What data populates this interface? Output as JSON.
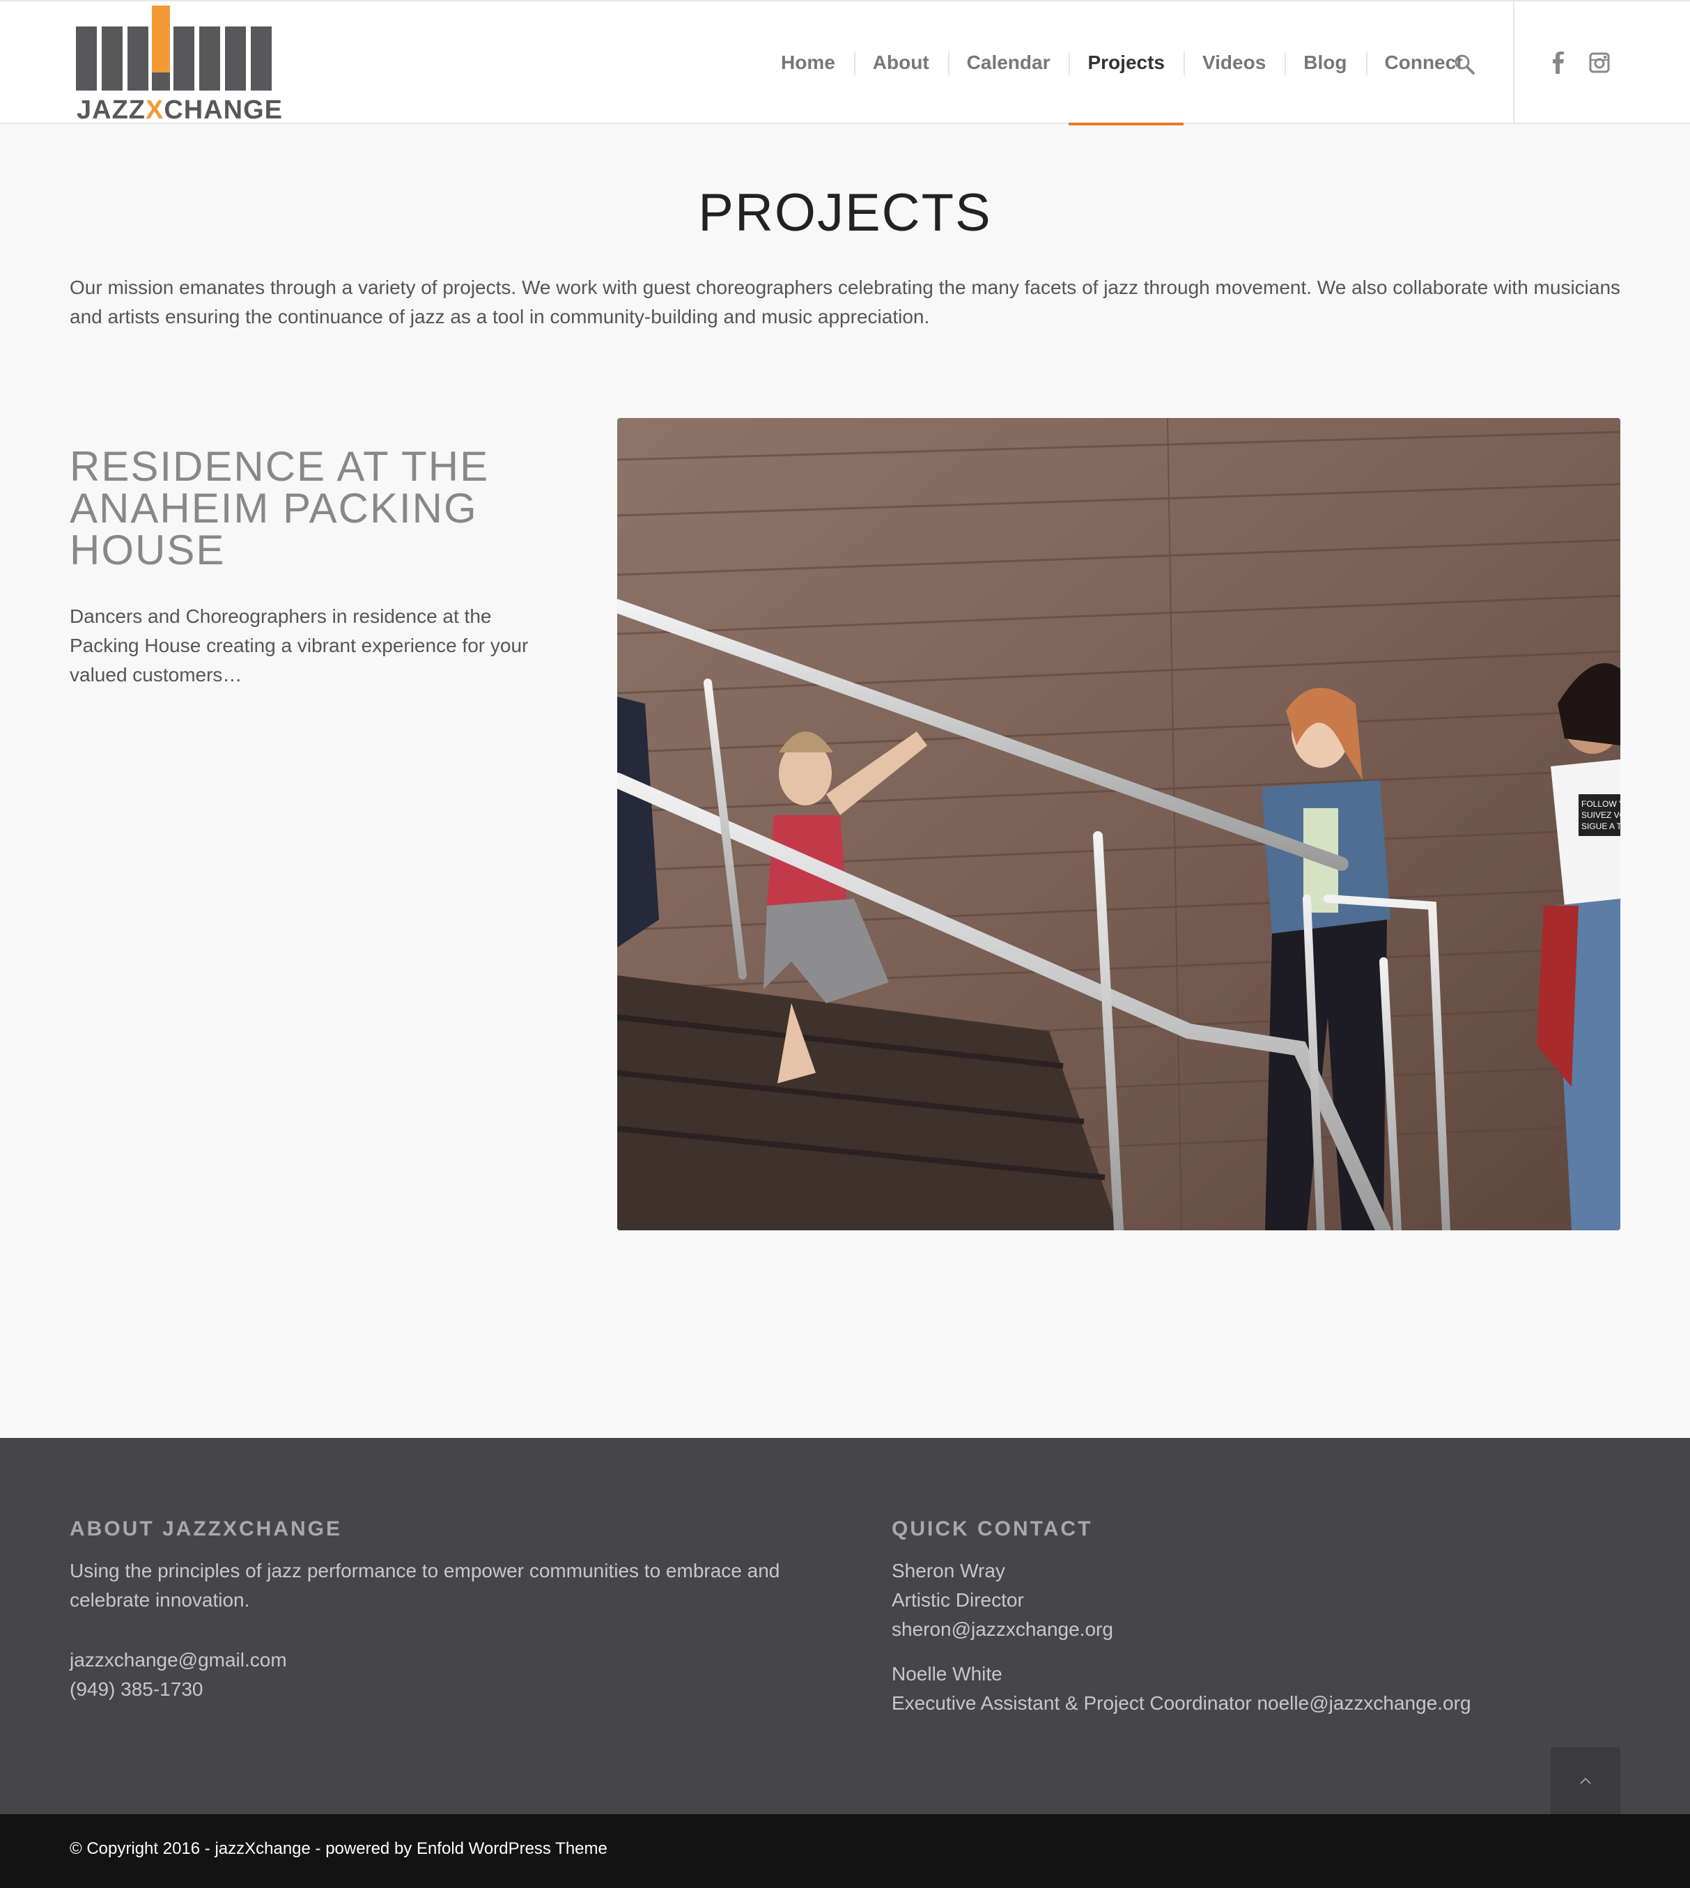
{
  "brand": {
    "name": "jazzXchange",
    "logo_text_left": "JAZZ",
    "logo_text_x": "X",
    "logo_text_right": "CHANGE",
    "colors": {
      "gray": "#58585a",
      "orange": "#f29a36",
      "accent": "#ea7a2e"
    }
  },
  "nav": {
    "items": [
      {
        "label": "Home",
        "active": false
      },
      {
        "label": "About",
        "active": false
      },
      {
        "label": "Calendar",
        "active": false
      },
      {
        "label": "Projects",
        "active": true
      },
      {
        "label": "Videos",
        "active": false
      },
      {
        "label": "Blog",
        "active": false
      },
      {
        "label": "Connect",
        "active": false
      }
    ],
    "search_icon": "search-icon",
    "social_icons": [
      "facebook-icon",
      "instagram-icon"
    ]
  },
  "main": {
    "title": "PROJECTS",
    "mission": "Our mission emanates through a variety of projects. We work with guest choreographers celebrating the many facets of jazz through movement. We also collaborate with musicians and artists ensuring the continuance of jazz as a tool in community-building and music appreciation.",
    "project": {
      "title_line1": "RESIDENCE AT THE",
      "title_line2": "ANAHEIM PACKING",
      "title_line3": "HOUSE",
      "description": "Dancers and Choreographers in residence at the Packing House creating a vibrant experience for your valued customers…",
      "photo_shirt_text_1": "FOLLOW YOUR",
      "photo_shirt_text_2": "SUIVEZ VOTRE",
      "photo_shirt_text_3": "SIGUE A TU C"
    }
  },
  "footer": {
    "about": {
      "heading": "ABOUT JAZZXCHANGE",
      "text_line1": "Using the principles of jazz performance to empower communities to embrace and",
      "text_line2": "celebrate innovation.",
      "email": "jazzxchange@gmail.com",
      "phone": "(949) 385-1730"
    },
    "contact": {
      "heading": "QUICK CONTACT",
      "person1_name": "Sheron Wray",
      "person1_role": "Artistic Director",
      "person1_email": "sheron@jazzxchange.org",
      "person2_name": "Noelle White",
      "person2_role_email": "Executive Assistant & Project Coordinator noelle@jazzxchange.org"
    },
    "copyright": "© Copyright 2016 - jazzXchange - powered by Enfold WordPress Theme",
    "scroll_top_icon": "chevron-up-icon"
  }
}
